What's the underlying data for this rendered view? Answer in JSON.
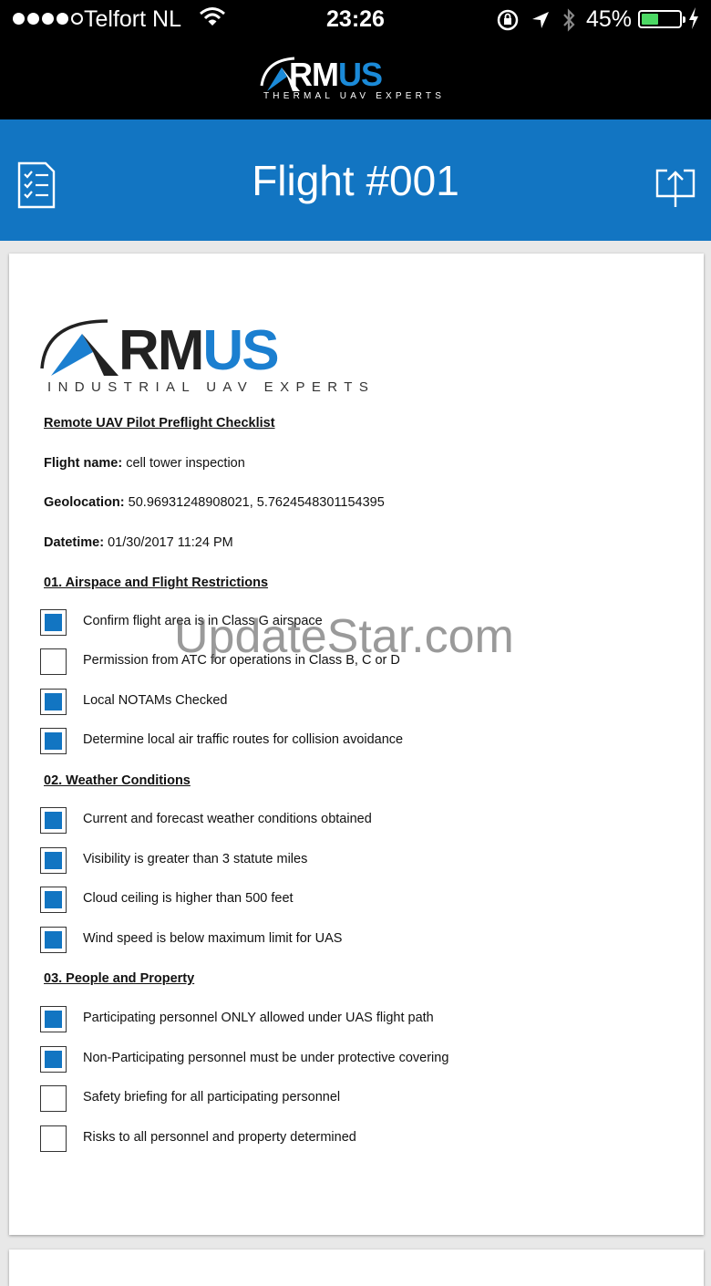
{
  "status_bar": {
    "carrier": "Telfort NL",
    "time": "23:26",
    "battery_percent": "45%",
    "battery_level": 0.45
  },
  "header": {
    "logo_word": "RMUS",
    "logo_tagline": "THERMAL UAV EXPERTS",
    "title": "Flight #001"
  },
  "document": {
    "logo_word": "RMUS",
    "logo_tagline": "INDUSTRIAL UAV EXPERTS",
    "title": "Remote UAV Pilot Preflight Checklist",
    "flight_name_label": "Flight name:",
    "flight_name": "cell tower inspection",
    "geolocation_label": "Geolocation:",
    "geolocation": "50.96931248908021, 5.7624548301154395",
    "datetime_label": "Datetime:",
    "datetime": "01/30/2017 11:24 PM",
    "sections": [
      {
        "title": "01. Airspace and Flight Restrictions",
        "items": [
          {
            "label": "Confirm flight area is in Class G airspace",
            "checked": true
          },
          {
            "label": "Permission from ATC for operations in Class B, C or D",
            "checked": false
          },
          {
            "label": "Local NOTAMs Checked",
            "checked": true
          },
          {
            "label": "Determine local air traffic routes for collision avoidance",
            "checked": true
          }
        ]
      },
      {
        "title": "02. Weather Conditions",
        "items": [
          {
            "label": "Current and forecast weather conditions obtained",
            "checked": true
          },
          {
            "label": "Visibility is greater than 3 statute miles",
            "checked": true
          },
          {
            "label": "Cloud ceiling is higher than 500 feet",
            "checked": true
          },
          {
            "label": "Wind speed is below maximum limit for UAS",
            "checked": true
          }
        ]
      },
      {
        "title": "03. People and Property",
        "items": [
          {
            "label": "Participating personnel ONLY allowed under UAS flight path",
            "checked": true
          },
          {
            "label": "Non-Participating personnel must be under protective covering",
            "checked": true
          },
          {
            "label": "Safety briefing for all participating personnel",
            "checked": false
          },
          {
            "label": "Risks to all personnel and property determined",
            "checked": false
          }
        ]
      }
    ]
  },
  "watermark": "UpdateStar.com",
  "colors": {
    "accent": "#1275c2",
    "topbar": "#000000",
    "battery": "#4cd964"
  }
}
